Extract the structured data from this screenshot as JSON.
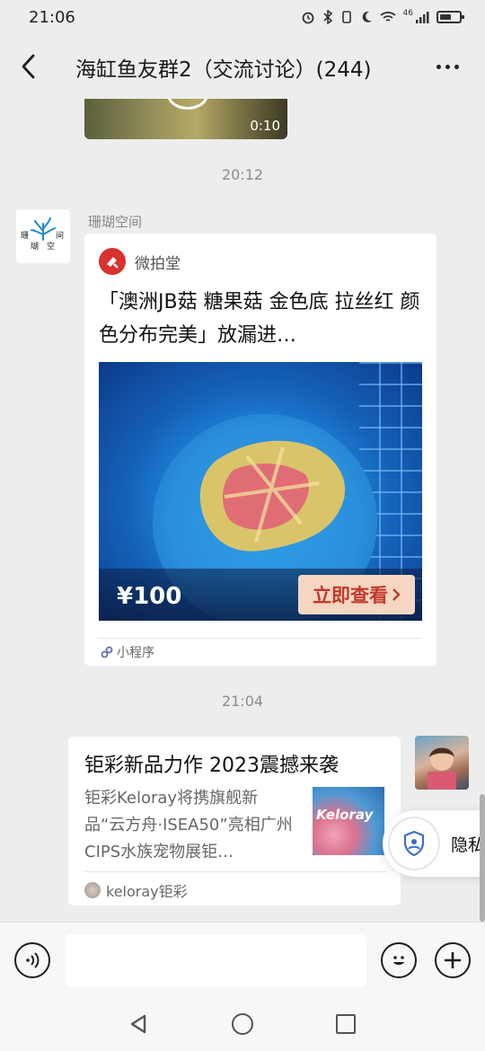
{
  "status": {
    "time": "21:06",
    "network": "46",
    "icons": [
      "alarm-icon",
      "bluetooth-icon",
      "vibrate-icon",
      "moon-icon",
      "wifi-icon",
      "signal-icon",
      "battery-icon"
    ]
  },
  "header": {
    "title": "海缸鱼友群2（交流讨论）(244)",
    "back_icon": "chevron-left-icon",
    "more_icon": "ellipsis-icon"
  },
  "chat": {
    "prev_video_duration": "0:10",
    "time_1": "20:12",
    "msg1": {
      "sender": "珊瑚空间",
      "avatar_text": [
        "珊",
        "间",
        "瑚",
        "空"
      ],
      "mini_source": "微拍堂",
      "mini_title": "「澳洲JB菇 糖果菇 金色底 拉丝红 颜色分布完美」放漏进…",
      "price": "¥100",
      "cta": "立即查看",
      "footer": "小程序"
    },
    "time_2": "21:04",
    "msg2": {
      "title": "钜彩新品力作 2023震撼来袭",
      "desc": "钜彩Keloray将携旗舰新品“云方舟·ISEA50”亮相广州CIPS水族宠物展钜…",
      "thumb_text": "Keloray",
      "source": "keloray钜彩"
    }
  },
  "privacy": {
    "label": "隐私"
  },
  "input": {
    "placeholder": ""
  },
  "colors": {
    "chat_bg": "#ededed",
    "bubble_bg": "#ffffff",
    "cta_bg": "#f5d6c2",
    "cta_text": "#c23a2a",
    "mini_logo": "#d8312e"
  }
}
